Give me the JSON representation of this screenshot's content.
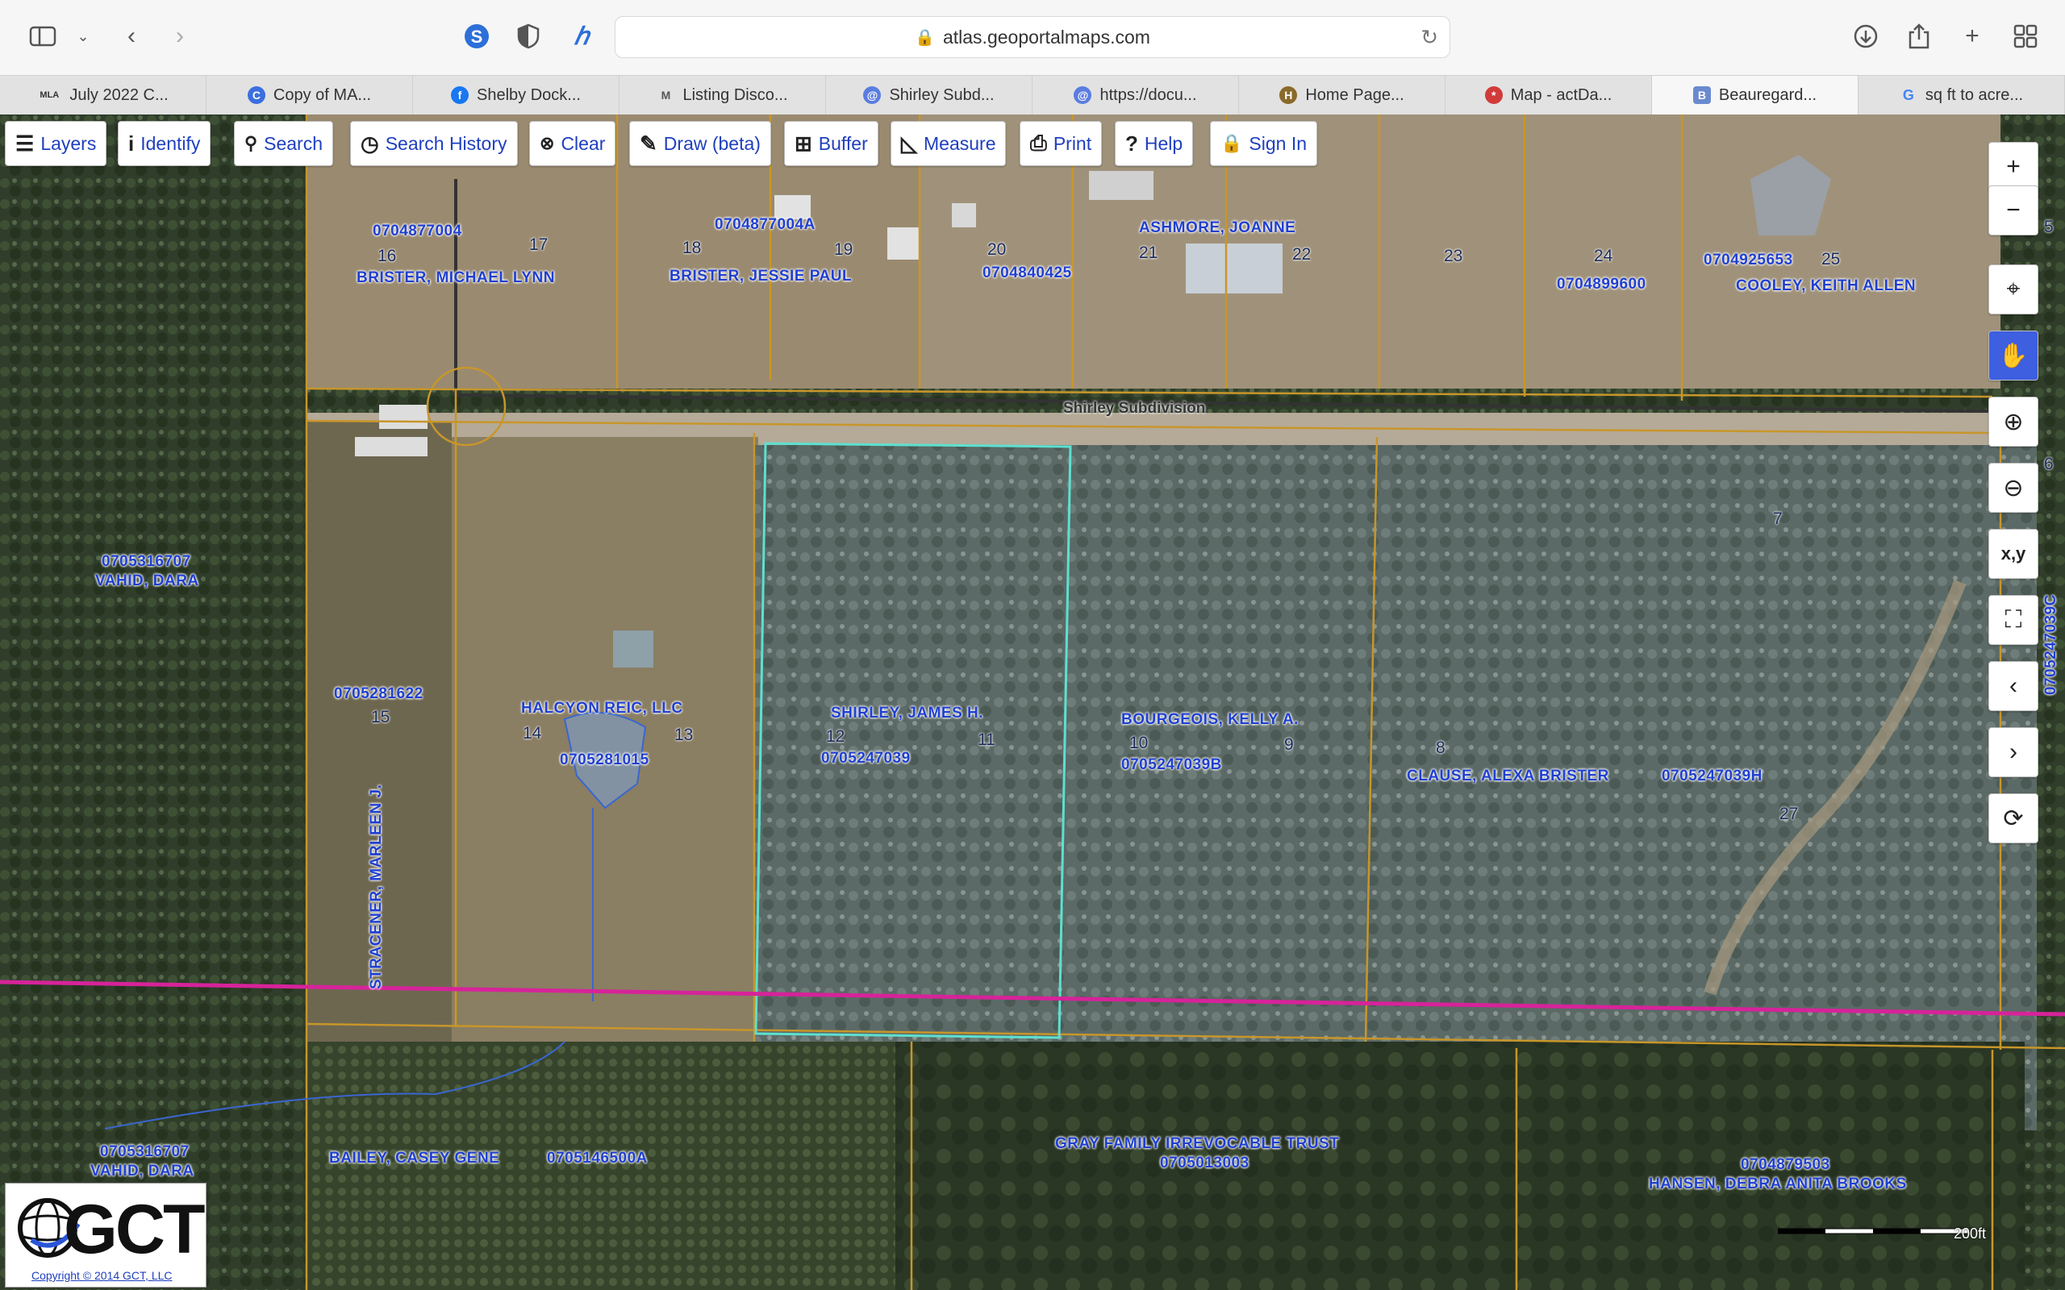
{
  "browser": {
    "url": "atlas.geoportalmaps.com",
    "tabs": [
      {
        "label": "July 2022 C...",
        "icon": "MLA",
        "color": "#ffffff"
      },
      {
        "label": "Copy of MA...",
        "icon": "C",
        "color": "#3b6fe0"
      },
      {
        "label": "Shelby Dock...",
        "icon": "f",
        "color": "#1877f2"
      },
      {
        "label": "Listing Disco...",
        "icon": "M",
        "color": "#ffffff"
      },
      {
        "label": "Shirley Subd...",
        "icon": "@",
        "color": "#5a7de0"
      },
      {
        "label": "https://docu...",
        "icon": "@",
        "color": "#5a7de0"
      },
      {
        "label": "Home Page...",
        "icon": "H",
        "color": "#8a6a2a"
      },
      {
        "label": "Map - actDa...",
        "icon": "*",
        "color": "#d23a3a"
      },
      {
        "label": "Beauregard...",
        "icon": "B",
        "color": "#6a8ad0"
      },
      {
        "label": "sq ft to acre...",
        "icon": "G",
        "color": "#ffffff"
      }
    ]
  },
  "toolbar": {
    "layers": "Layers",
    "identify": "Identify",
    "search": "Search",
    "search_history": "Search History",
    "clear": "Clear",
    "draw": "Draw (beta)",
    "buffer": "Buffer",
    "measure": "Measure",
    "print": "Print",
    "help": "Help",
    "sign_in": "Sign In"
  },
  "right_tools": {
    "xy": "x,y"
  },
  "map": {
    "road_name": "Shirley Subdivision",
    "owners": {
      "brister_michael": "BRISTER, MICHAEL LYNN",
      "brister_jessie": "BRISTER, JESSIE PAUL",
      "ashmore": "ASHMORE, JOANNE",
      "cooley": "COOLEY, KEITH ALLEN",
      "vahid_1": "VAHID, DARA",
      "vahid_2": "VAHID, DARA",
      "halcyon": "HALCYON REIC, LLC",
      "shirley": "SHIRLEY, JAMES H.",
      "bourgeois": "BOURGEOIS, KELLY A.",
      "clause": "CLAUSE, ALEXA BRISTER",
      "stracener": "STRACENER, MARLEEN J.",
      "bailey": "BAILEY, CASEY GENE",
      "gray": "GRAY FAMILY IRREVOCABLE TRUST",
      "hansen": "HANSEN, DEBRA ANITA BROOKS"
    },
    "parcels": {
      "p_0704877004": "0704877004",
      "p_0704877004A": "0704877004A",
      "p_0704840425": "0704840425",
      "p_0704899600": "0704899600",
      "p_0704925653": "0704925653",
      "p_0705316707_1": "0705316707",
      "p_0705316707_2": "0705316707",
      "p_0705281622": "0705281622",
      "p_0705281015": "0705281015",
      "p_0705247039": "0705247039",
      "p_0705247039B": "0705247039B",
      "p_0705247039H": "0705247039H",
      "p_0705247039C": "0705247039C",
      "p_0705146500A": "0705146500A",
      "p_0705013003": "0705013003",
      "p_0704879503": "0704879503"
    },
    "lots": [
      "16",
      "17",
      "18",
      "19",
      "20",
      "21",
      "22",
      "23",
      "24",
      "25",
      "5",
      "6",
      "7",
      "15",
      "14",
      "13",
      "12",
      "11",
      "10",
      "9",
      "8",
      "27"
    ]
  },
  "scale_label": "200ft",
  "logo": {
    "text": "GCT",
    "copyright": "Copyright © 2014 GCT, LLC"
  }
}
